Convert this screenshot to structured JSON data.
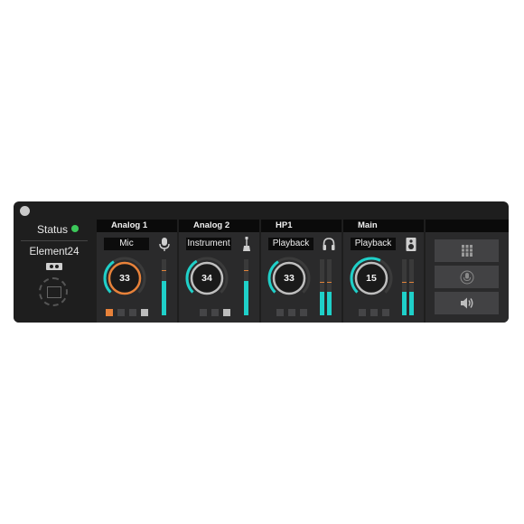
{
  "status": {
    "label": "Status",
    "dot_color": "#3cc85a"
  },
  "device": {
    "name": "Element24"
  },
  "accent_colors": {
    "teal": "#1fd0c9",
    "orange": "#e8823a"
  },
  "channels": [
    {
      "title": "Analog 1",
      "mode": "Mic",
      "value": "33",
      "icon": "microphone-icon"
    },
    {
      "title": "Analog 2",
      "mode": "Instrument",
      "value": "34",
      "icon": "guitar-icon"
    },
    {
      "title": "HP1",
      "mode": "Playback",
      "value": "33",
      "icon": "headphones-icon"
    },
    {
      "title": "Main",
      "mode": "Playback",
      "value": "15",
      "icon": "speaker-icon"
    }
  ],
  "side_buttons": [
    "levels-meter-icon",
    "microphone-icon",
    "speaker-volume-icon"
  ]
}
